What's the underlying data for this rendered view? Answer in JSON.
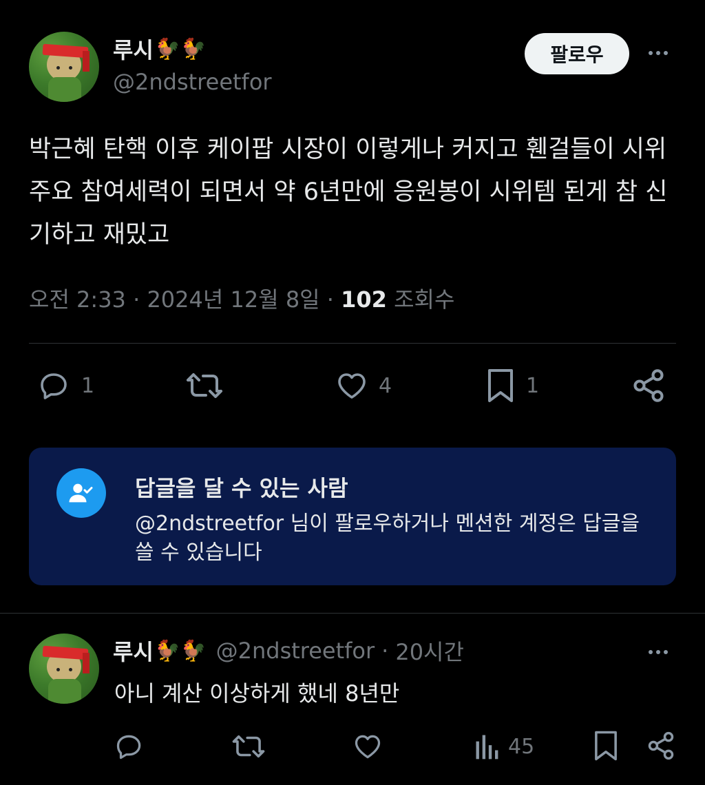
{
  "tweet": {
    "display_name": "루시",
    "emoji": "🐓🐓",
    "handle": "@2ndstreetfor",
    "follow_label": "팔로우",
    "text": "박근혜 탄핵 이후 케이팝 시장이 이렇게나 커지고 휀걸들이 시위 주요 참여세력이 되면서 약 6년만에 응원봉이 시위템 된게 참 신기하고 재밌고",
    "time": "오전 2:33",
    "date": "2024년 12월 8일",
    "separator": "·",
    "views_count": "102",
    "views_label": "조회수",
    "actions": {
      "reply_count": "1",
      "like_count": "4",
      "bookmark_count": "1"
    }
  },
  "reply_permission": {
    "title": "답글을 달 수 있는 사람",
    "description": "@2ndstreetfor 님이 팔로우하거나 멘션한 계정은 답글을 쓸 수 있습니다"
  },
  "reply": {
    "display_name": "루시",
    "emoji": "🐓🐓",
    "handle": "@2ndstreetfor",
    "time": "20시간",
    "text": "아니 계산 이상하게 했네 8년만",
    "views_count": "45"
  },
  "colors": {
    "background": "#000000",
    "text": "#e7e9ea",
    "muted": "#71767b",
    "accent": "#1d9bf0",
    "reply_card": "#0a1a4a"
  },
  "icons": [
    "reply-icon",
    "retweet-icon",
    "like-icon",
    "bookmark-icon",
    "share-icon",
    "views-icon",
    "more-icon",
    "person-check-icon"
  ]
}
